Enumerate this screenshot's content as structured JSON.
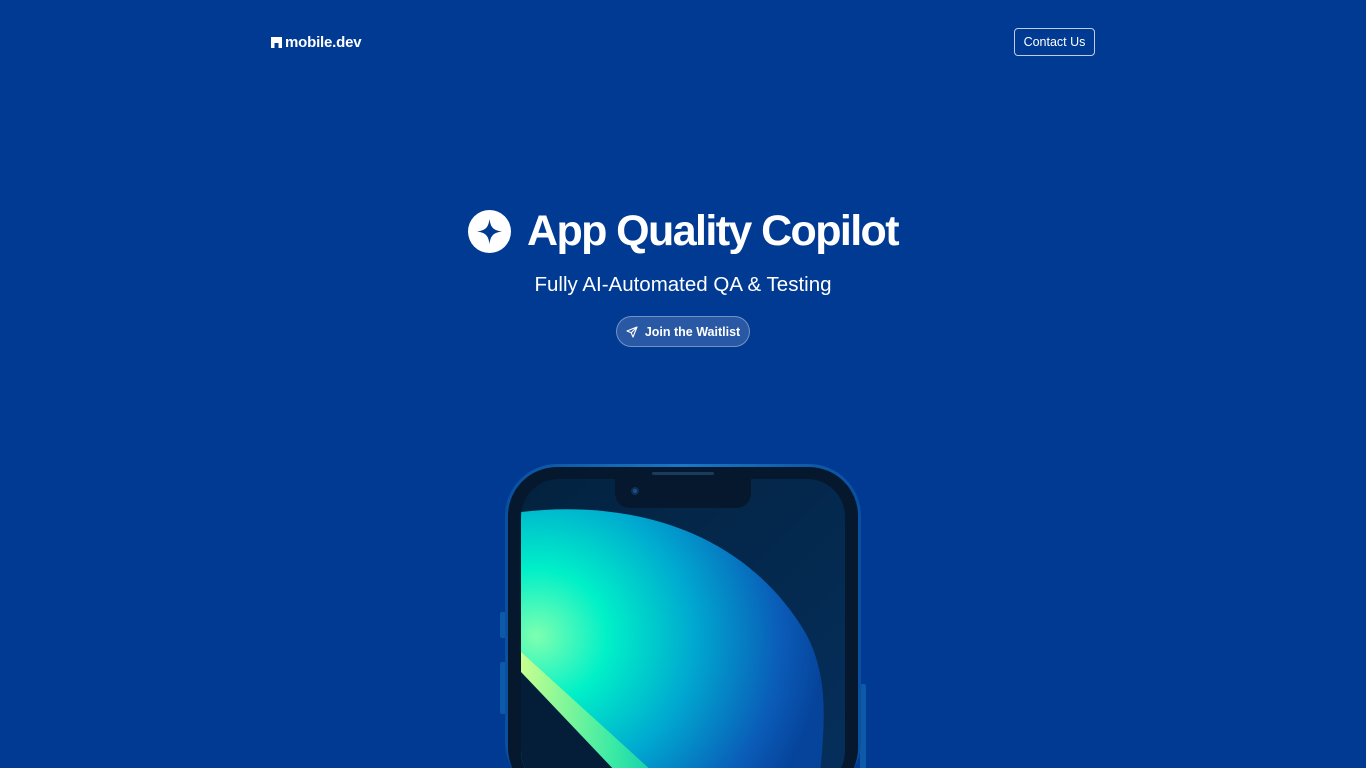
{
  "header": {
    "logo_text": "mobile.dev",
    "contact_label": "Contact Us"
  },
  "hero": {
    "title": "App Quality Copilot",
    "subtitle": "Fully AI-Automated QA & Testing",
    "cta_label": "Join the Waitlist"
  },
  "icons": {
    "logo": "mobile-dev-logo-icon",
    "title": "sparkle-icon",
    "cta": "send-icon"
  },
  "colors": {
    "background": "#003a93",
    "text": "#ffffff",
    "phone_frame": "#1a6fb8",
    "screen_accent": "#00e0c0"
  }
}
